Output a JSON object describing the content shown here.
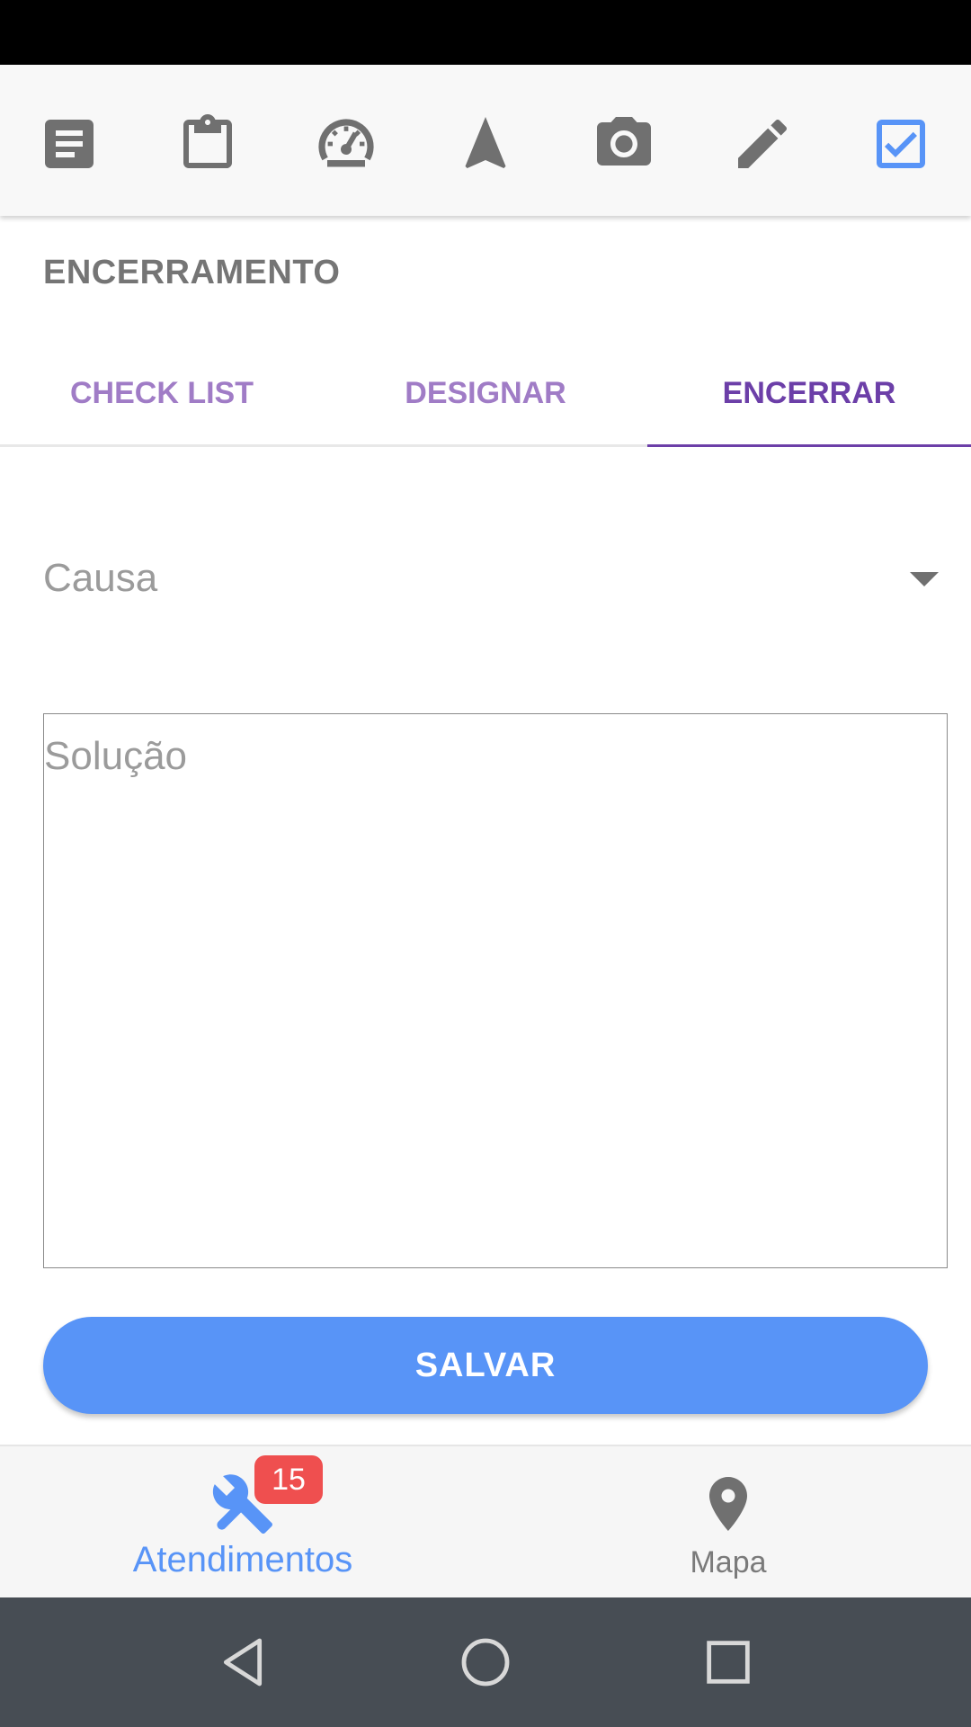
{
  "toolbar": {
    "icons": [
      "document-icon",
      "clipboard-icon",
      "speedometer-icon",
      "navigation-arrow-icon",
      "camera-icon",
      "pencil-icon",
      "checkbox-checked-icon"
    ],
    "icon_color": "#707070",
    "active_icon_color": "#5894f7"
  },
  "section": {
    "title": "ENCERRAMENTO"
  },
  "tabs": [
    {
      "label": "CHECK LIST",
      "active": false
    },
    {
      "label": "DESIGNAR",
      "active": false
    },
    {
      "label": "ENCERRAR",
      "active": true
    }
  ],
  "form": {
    "cause_select": {
      "label": "Causa",
      "value": ""
    },
    "solution_textarea": {
      "placeholder": "Solução",
      "value": ""
    },
    "save_label": "SALVAR"
  },
  "bottom_nav": {
    "items": [
      {
        "label": "Atendimentos",
        "icon": "tools-icon",
        "badge": "15",
        "active": true
      },
      {
        "label": "Mapa",
        "icon": "map-pin-icon",
        "active": false
      }
    ]
  },
  "colors": {
    "accent": "#5894f7",
    "tab_active": "#6c3fa8",
    "tab_inactive": "#a07cc6",
    "badge": "#ef4f4f",
    "system_nav": "#474d54"
  }
}
